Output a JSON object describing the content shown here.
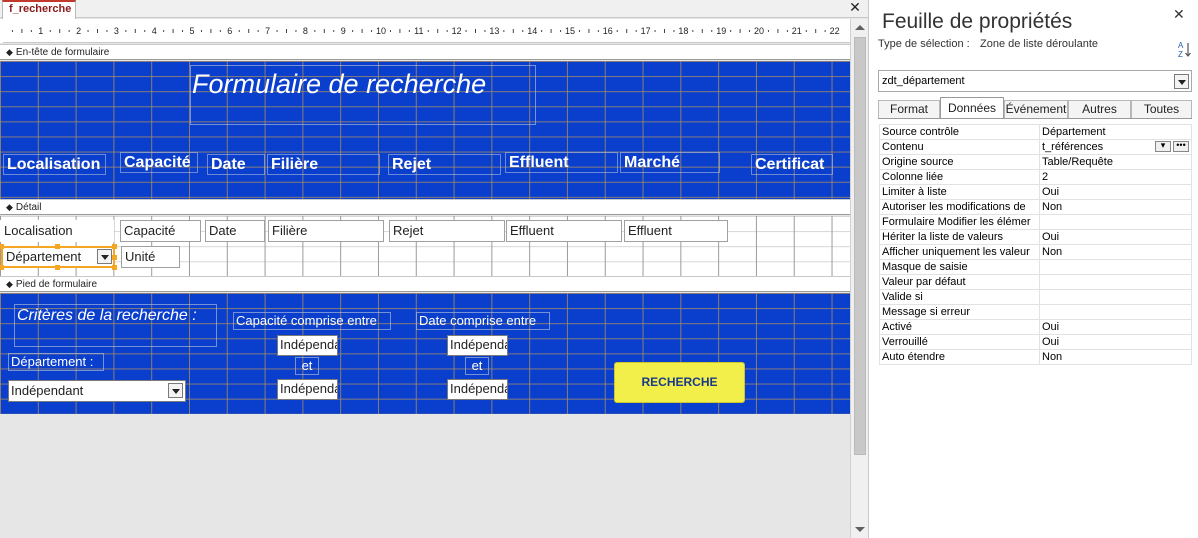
{
  "document_tab": {
    "title": "f_recherche",
    "close_glyph": "✕"
  },
  "ruler": {
    "numbers": [
      "1",
      "2",
      "3",
      "4",
      "5",
      "6",
      "7",
      "8",
      "9",
      "10",
      "11",
      "12",
      "13",
      "14",
      "15",
      "16",
      "17",
      "18",
      "19",
      "20",
      "21",
      "22"
    ]
  },
  "sections": {
    "header": "En-tête de formulaire",
    "detail": "Détail",
    "footer": "Pied de formulaire"
  },
  "form_header": {
    "title": "Formulaire de recherche",
    "columns": [
      "Localisation",
      "Capacité",
      "Date",
      "Filière",
      "Rejet",
      "Effluent",
      "Marché",
      "Certificat"
    ]
  },
  "detail": {
    "fields": [
      "Localisation",
      "Capacité",
      "Date",
      "Filière",
      "Rejet",
      "Effluent",
      "Effluent"
    ],
    "departement_combo": "Département",
    "unite_field": "Unité"
  },
  "form_footer": {
    "criteria_title": "Critères de la recherche :",
    "departement_label": "Département :",
    "departement_value": "Indépendant",
    "capacite_label": "Capacité comprise entre",
    "date_label": "Date comprise entre",
    "cap_from": "Indépendant",
    "cap_and": "et",
    "cap_to": "Indépendant",
    "date_from": "Indépendant",
    "date_and": "et",
    "date_to": "Indépendant",
    "search_button": "RECHERCHE"
  },
  "property_sheet": {
    "title": "Feuille de propriétés",
    "close_glyph": "✕",
    "selection_type_label": "Type de sélection :",
    "selection_type_value": "Zone de liste déroulante",
    "object": "zdt_département",
    "tabs": [
      "Format",
      "Données",
      "Événement",
      "Autres",
      "Toutes"
    ],
    "active_tab": "Données",
    "rows": [
      {
        "name": "Source contrôle",
        "value": "Département"
      },
      {
        "name": "Contenu",
        "value": "t_références"
      },
      {
        "name": "Origine source",
        "value": "Table/Requête"
      },
      {
        "name": "Colonne liée",
        "value": "2"
      },
      {
        "name": "Limiter à liste",
        "value": "Oui"
      },
      {
        "name": "Autoriser les modifications de",
        "value": "Non"
      },
      {
        "name": "Formulaire Modifier les élémer",
        "value": ""
      },
      {
        "name": "Hériter la liste de valeurs",
        "value": "Oui"
      },
      {
        "name": "Afficher uniquement les valeur",
        "value": "Non"
      },
      {
        "name": "Masque de saisie",
        "value": ""
      },
      {
        "name": "Valeur par défaut",
        "value": ""
      },
      {
        "name": "Valide si",
        "value": ""
      },
      {
        "name": "Message si erreur",
        "value": ""
      },
      {
        "name": "Activé",
        "value": "Oui"
      },
      {
        "name": "Verrouillé",
        "value": "Oui"
      },
      {
        "name": "Auto étendre",
        "value": "Non"
      }
    ],
    "builder_glyph": "•••"
  },
  "colors": {
    "form_blue": "#0a3fce",
    "button_yellow": "#f2ef4a",
    "selection_orange": "#f5a623",
    "tab_accent": "#c0392b"
  }
}
